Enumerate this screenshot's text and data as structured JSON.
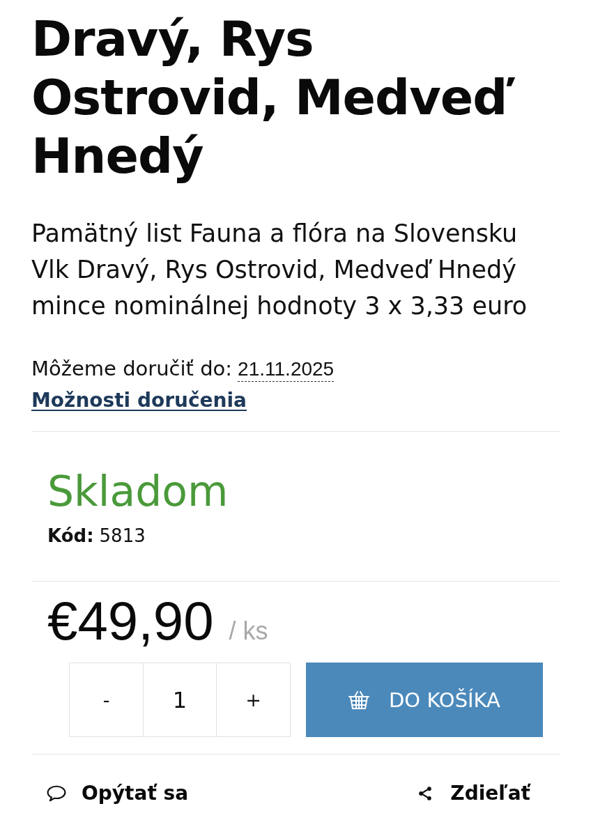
{
  "product": {
    "title": "Dravý, Rys Ostrovid, Medveď Hnedý",
    "description": "Pamätný list Fauna a flóra na Slovensku Vlk Dravý, Rys Ostrovid, Medveď Hnedý mince nominálnej hodnoty 3 x 3,33 euro"
  },
  "delivery": {
    "label": "Môžeme doručiť do:",
    "date": "21.11.2025",
    "link": "Možnosti doručenia"
  },
  "availability": {
    "label": "Skladom",
    "in_stock": true,
    "code_label": "Kód:",
    "code": "5813"
  },
  "price": {
    "amount": "€49,90",
    "unit": "/ ks"
  },
  "quantity": {
    "minus": "-",
    "value": "1",
    "plus": "+"
  },
  "add_to_cart": {
    "label": "DO KOŠÍKA"
  },
  "actions": [
    {
      "kind": "ask",
      "label": "Opýtať sa"
    },
    {
      "kind": "share",
      "label": "Zdieľať"
    }
  ]
}
